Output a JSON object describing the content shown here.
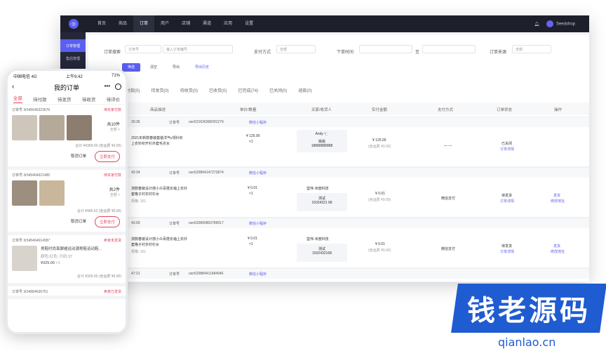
{
  "desktop": {
    "nav": [
      "首页",
      "商品",
      "订单",
      "用户",
      "店铺",
      "渠道",
      "应用",
      "设置"
    ],
    "active_nav": "订单",
    "user": "Seedshop",
    "sidebar": [
      "订单管理",
      "售后管理"
    ],
    "filters": {
      "order_search_label": "订单搜索",
      "order_no_select": "订单号",
      "order_no_placeholder": "输入订单编号",
      "pay_method_label": "支付方式",
      "pay_method_value": "全部",
      "order_time_label": "下单时间",
      "time_sep": "至",
      "source_label": "订单来源",
      "source_value": "全部"
    },
    "buttons": {
      "filter": "筛选",
      "clear": "清空",
      "export": "导出",
      "export_history": "导出历史"
    },
    "tabs": [
      "待付款(0)",
      "待发货(0)",
      "待收货(0)",
      "已收货(0)",
      "已完成(74)",
      "已关闭(0)",
      "退款(0)"
    ],
    "columns": [
      "商品描述",
      "单价/数量",
      "买家/收货人",
      "实付金额",
      "支付方式",
      "订单状态",
      "操作"
    ],
    "orders": [
      {
        "time": "20:36",
        "order_no_label": "订单号",
        "order_no": "osn521636368291279",
        "channel": "微信小程序",
        "desc1": "2021年新款春装套装洋气v领针织",
        "desc2": "上衣针织开衫外套毛衣女",
        "price": "¥ 125.00",
        "qty": "×1",
        "buyer": "Andy 🐑",
        "receiver": "姚姚",
        "phone": "18888888888",
        "paid": "¥ 125.00",
        "paid_note": "(含运费 ¥0.00)",
        "pay_method": "— —",
        "status": "已关闭",
        "status_link": "订单详情",
        "ops": []
      },
      {
        "time": "43:34",
        "order_no_label": "订单号",
        "order_no": "osn520894147273874",
        "channel": "微信小程序",
        "desc1": "测款春装设计感小众百搭长袖上衣外",
        "desc2": "套格子衬衣衬衫女",
        "spec": "规格: 101",
        "price": "¥ 0.01",
        "qty": "×1",
        "buyer": "瑩伟·米度科技",
        "receiver": "测试",
        "phone": "15024321 68",
        "paid": "¥ 0.01",
        "paid_note": "(含运费 ¥0.00)",
        "pay_method": "微信支付",
        "status": "待发货",
        "status_link": "订单详情",
        "ops": [
          "发货",
          "修改地址"
        ]
      },
      {
        "time": "43:00",
        "order_no_label": "订单号",
        "order_no": "osn520890803789917",
        "channel": "微信小程序",
        "desc1": "测款春装设计感小众百搭长袖上衣外",
        "desc2": "套格子衬衣衬衫女",
        "spec": "规格: 101",
        "price": "¥ 0.01",
        "qty": "×1",
        "buyer": "瑩伟·米度科技",
        "receiver": "测试",
        "phone": "1502432168",
        "paid": "¥ 0.01",
        "paid_note": "(含运费 ¥0.00)",
        "pay_method": "微信支付",
        "status": "待发货",
        "status_link": "订单详情",
        "ops": [
          "发货",
          "修改地址"
        ]
      },
      {
        "time": "47:21",
        "order_no_label": "订单号",
        "order_no": "osn520884411684946",
        "channel": "微信小程序"
      }
    ]
  },
  "phone": {
    "status_left": "中国电信 4G",
    "status_time": "上午9:42",
    "status_right": "71%",
    "title": "我的订单",
    "menu": "•••",
    "tabs": [
      "全部",
      "待付款",
      "待发货",
      "待收货",
      "待评价"
    ],
    "cards": [
      {
        "order_no": "订单号 3r545646323676",
        "status": "待买家付款",
        "count": "共10件",
        "more": "全部 >",
        "summary": "合计 ¥4369.00 (含运费 ¥0.00)",
        "actions": [
          "取消订单",
          "立即支付"
        ]
      },
      {
        "order_no": "订单号 3r545464621485",
        "status": "待买家付款",
        "count": "共2件",
        "more": "全部 >",
        "summary": "合计 ¥945.62 (含运费 ¥0.00)",
        "actions": [
          "取消订单",
          "立即支付"
        ]
      },
      {
        "order_no": "订单号 3r545464614587",
        "status": "卖家未发货",
        "product": "男鞋时尚束脚裙运动潮男鞋运动鞋...",
        "product_spec": "颜色:红色; 尺码:37",
        "product_price": "¥329.00",
        "product_qty": "×1",
        "summary": "合计 ¥329.00 (含运费 ¥0.00)",
        "actions": []
      },
      {
        "order_no": "订单号 3r54684636751",
        "status": "卖家已发货"
      }
    ]
  },
  "watermark": {
    "text": "钱老源码",
    "url": "qianlao.cn"
  },
  "colors": {
    "accent": "#5b5ff0",
    "phone_accent": "#e0435b",
    "topbar": "#1d1f2b",
    "watermark": "#1f5bd1"
  }
}
